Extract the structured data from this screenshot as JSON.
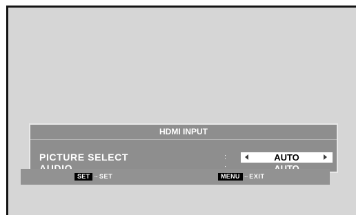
{
  "menu": {
    "title": "HDMI INPUT",
    "rows": [
      {
        "label": "PICTURE SELECT",
        "separator": ":",
        "value": "AUTO",
        "selected": true
      },
      {
        "label": "AUDIO",
        "separator": ":",
        "value": "AUTO",
        "selected": false
      }
    ]
  },
  "help": {
    "set_key": "SET",
    "set_dots": "∙∙∙",
    "set_text": "SET",
    "menu_key": "MENU",
    "menu_dots": "∙∙∙",
    "menu_text": "EXIT"
  },
  "icons": {
    "value_left": "triangle-left-icon",
    "value_right": "triangle-right-icon"
  },
  "colors": {
    "screen_background": "#d6d6d6",
    "panel_background": "#8e8e8e",
    "highlight_background": "#ffffff",
    "text": "#ffffff",
    "border": "#141414"
  }
}
